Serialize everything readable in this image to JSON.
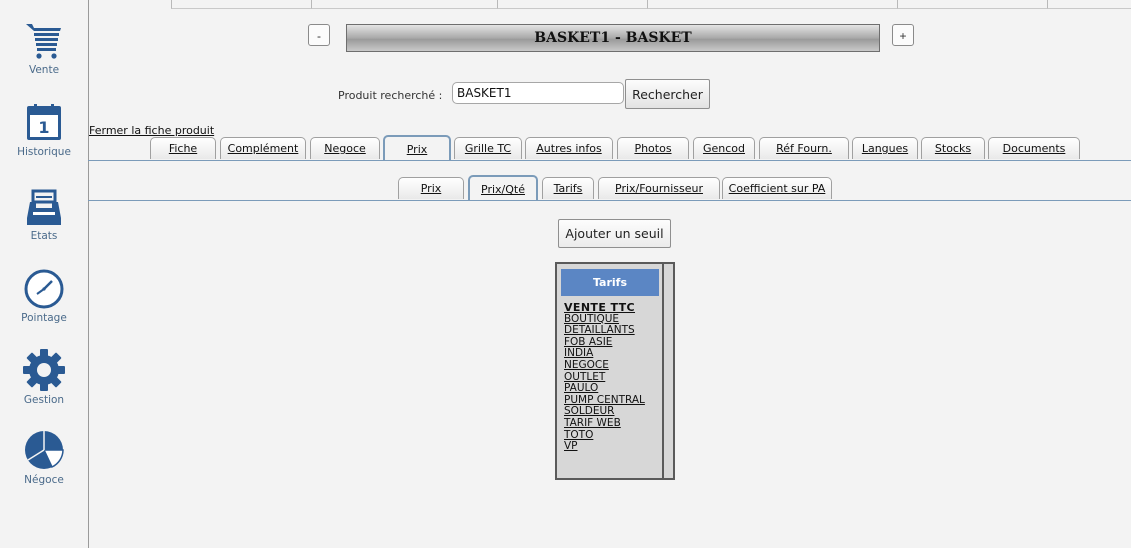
{
  "sidebar": {
    "items": [
      {
        "label": "Vente",
        "icon": "cart-icon"
      },
      {
        "label": "Historique",
        "icon": "calendar-icon",
        "icon_text": "1"
      },
      {
        "label": "Etats",
        "icon": "inbox-tray-icon"
      },
      {
        "label": "Pointage",
        "icon": "clock-icon"
      },
      {
        "label": "Gestion",
        "icon": "gear-icon"
      },
      {
        "label": "Négoce",
        "icon": "pie-chart-icon"
      }
    ]
  },
  "header": {
    "title": "BASKET1 - BASKET",
    "minus_label": "-",
    "plus_label": "+"
  },
  "search": {
    "label": "Produit recherché :",
    "value": "BASKET1",
    "button_label": "Rechercher"
  },
  "close_link": "Fermer la fiche produit",
  "main_tabs": {
    "items": [
      "Fiche",
      "Complément",
      "Negoce",
      "Prix",
      "Grille TC",
      "Autres infos",
      "Photos",
      "Gencod",
      "Réf Fourn.",
      "Langues",
      "Stocks",
      "Documents"
    ],
    "active": "Prix"
  },
  "sub_tabs": {
    "items": [
      "Prix",
      "Prix/Qté",
      "Tarifs",
      "Prix/Fournisseur",
      "Coefficient sur PA"
    ],
    "active": "Prix/Qté"
  },
  "add_threshold_label": "Ajouter un seuil",
  "tarifs_panel": {
    "header": "Tarifs",
    "items": [
      "VENTE TTC",
      "BOUTIQUE",
      "DETAILLANTS",
      "FOB ASIE",
      "INDIA",
      "NEGOCE",
      "OUTLET",
      "PAULO",
      "PUMP CENTRAL",
      "SOLDEUR",
      "TARIF WEB",
      "TOTO",
      "VP"
    ]
  },
  "colors": {
    "accent_blue": "#5b86c4",
    "tab_border": "#7b9bb9",
    "icon_blue": "#2a5a93"
  }
}
